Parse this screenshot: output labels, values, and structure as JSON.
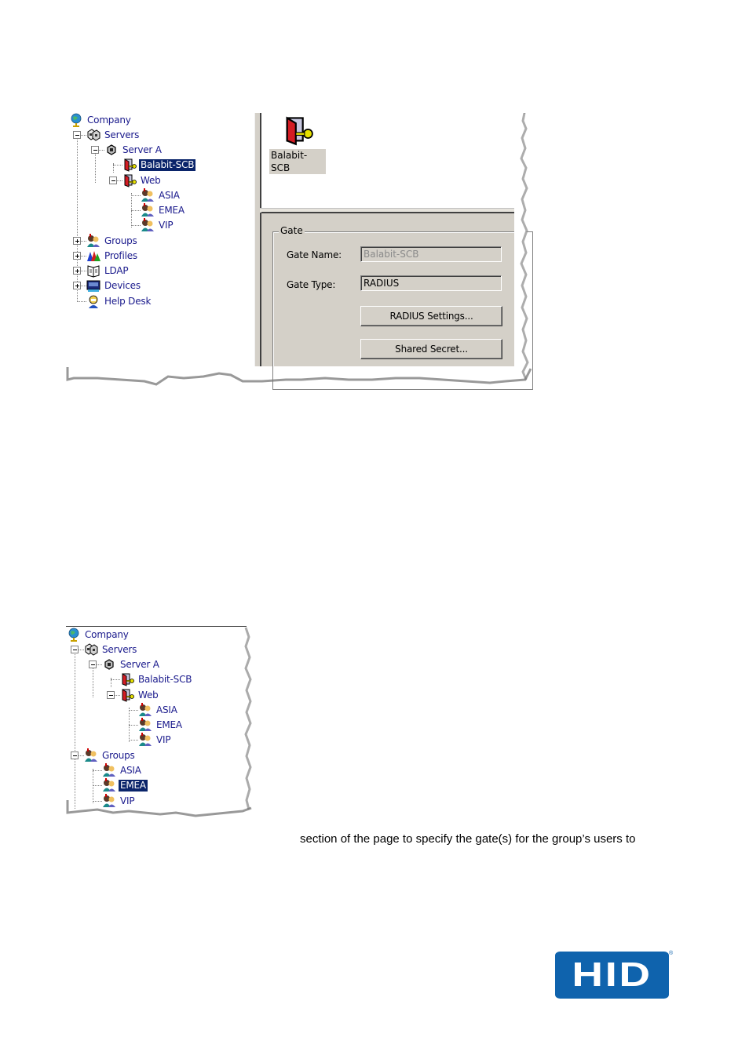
{
  "figure1": {
    "tree": {
      "root": "Company",
      "servers": "Servers",
      "server_a": "Server A",
      "balabit": "Balabit-SCB",
      "web": "Web",
      "web_asia": "ASIA",
      "web_emea": "EMEA",
      "web_vip": "VIP",
      "groups": "Groups",
      "profiles": "Profiles",
      "ldap": "LDAP",
      "devices": "Devices",
      "help_desk": "Help Desk",
      "selected": "Balabit-SCB"
    },
    "list_view": {
      "item_label": "Balabit-SCB",
      "item_icon": "gate-key-icon"
    },
    "gate_panel": {
      "group_title": "Gate",
      "gate_name_label": "Gate Name:",
      "gate_name_value": "Balabit-SCB",
      "gate_type_label": "Gate Type:",
      "gate_type_value": "RADIUS",
      "radius_settings_button": "RADIUS Settings...",
      "shared_secret_button": "Shared Secret..."
    }
  },
  "figure2": {
    "tree": {
      "root": "Company",
      "servers": "Servers",
      "server_a": "Server A",
      "balabit": "Balabit-SCB",
      "web": "Web",
      "web_asia": "ASIA",
      "web_emea": "EMEA",
      "web_vip": "VIP",
      "groups": "Groups",
      "group_asia": "ASIA",
      "group_emea": "EMEA",
      "group_vip": "VIP",
      "selected": "EMEA"
    }
  },
  "body_text": {
    "line1": "section of the page to specify the gate(s) for the group’s users to"
  },
  "logo": {
    "text": "HID",
    "registered": "®",
    "color": "#0f63ad"
  },
  "colors": {
    "selection": "#0a246a",
    "tree_text": "#1a1a8c",
    "dialog_bg": "#d4d0c8"
  }
}
